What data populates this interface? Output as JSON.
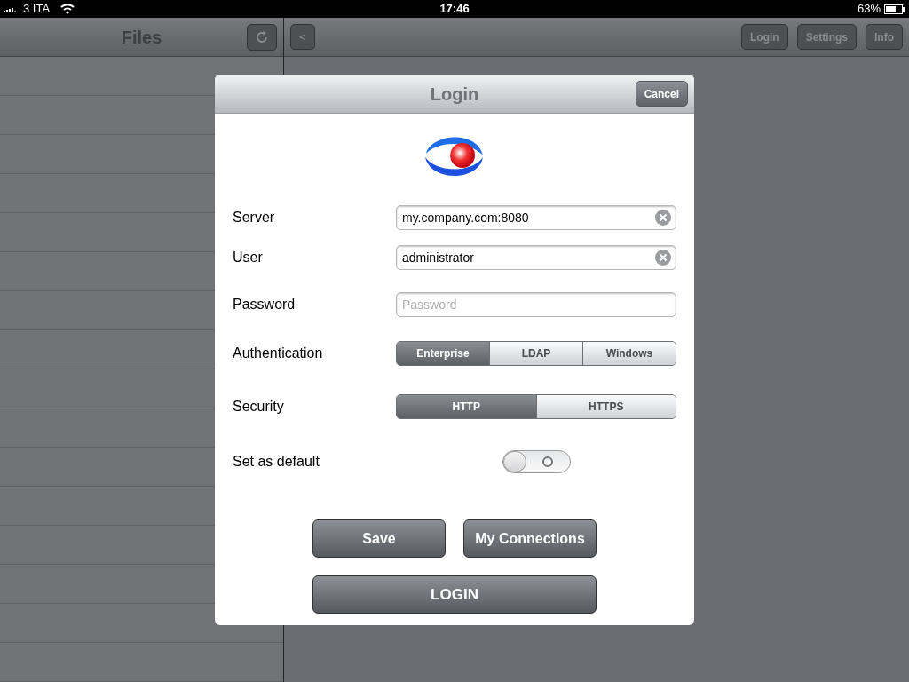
{
  "status_bar": {
    "carrier": "3 ITA",
    "time": "17:46",
    "battery": "63%"
  },
  "sidebar": {
    "title": "Files"
  },
  "toolbar": {
    "back": "<",
    "buttons": [
      "Login",
      "Settings",
      "Info"
    ]
  },
  "dialog": {
    "title": "Login",
    "cancel": "Cancel",
    "fields": [
      {
        "label": "Server",
        "value": "my.company.com:8080"
      },
      {
        "label": "User",
        "value": "administrator"
      },
      {
        "label": "Password",
        "placeholder": "Password"
      }
    ],
    "authentication": {
      "label": "Authentication",
      "options": [
        {
          "label": "Enterprise",
          "selected": true
        },
        {
          "label": "LDAP",
          "selected": false
        },
        {
          "label": "Windows",
          "selected": false
        }
      ]
    },
    "security": {
      "label": "Security",
      "options": [
        {
          "label": "HTTP",
          "selected": true
        },
        {
          "label": "HTTPS",
          "selected": false
        }
      ]
    },
    "default": {
      "label": "Set as default",
      "on": false
    },
    "buttons": [
      "Save",
      "My Connections"
    ],
    "login": "LOGIN"
  }
}
